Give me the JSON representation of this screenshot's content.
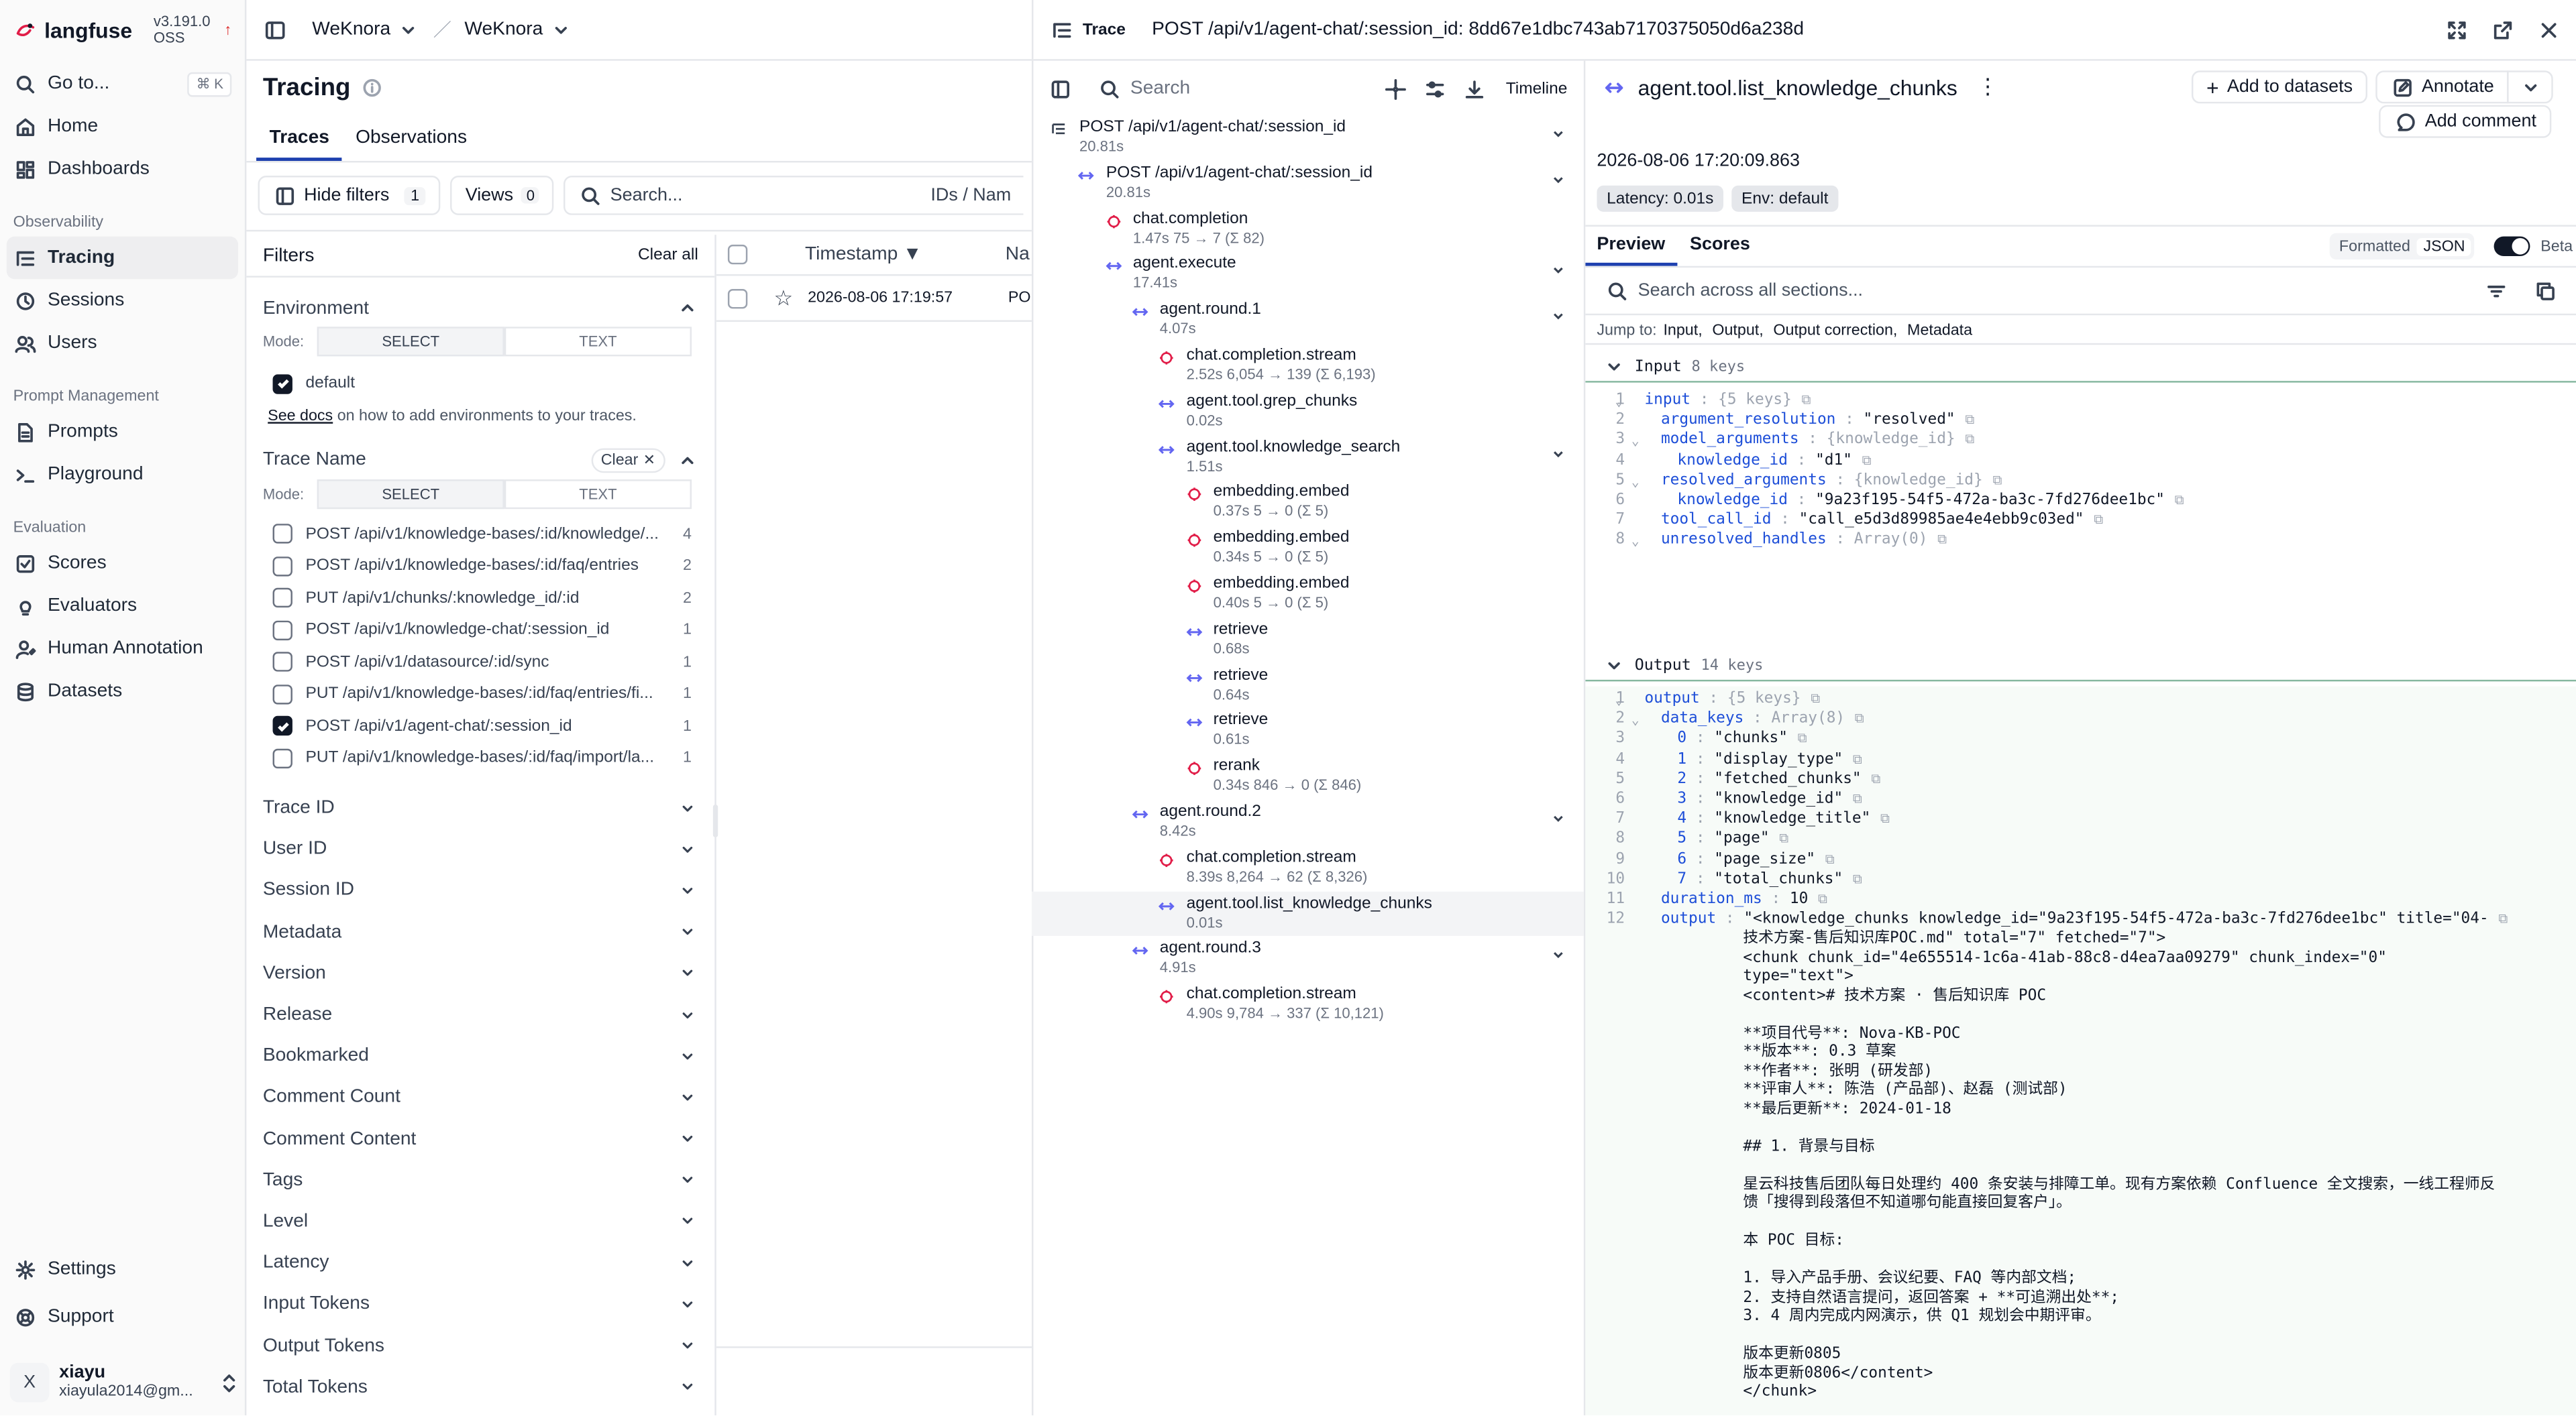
{
  "app": {
    "logo": "langfuse",
    "version": "v3.191.0 OSS"
  },
  "breadcrumb": [
    "WeKnora",
    "WeKnora"
  ],
  "sidebar": {
    "goto": "Go to...",
    "goto_shortcut": "⌘ K",
    "top": [
      "Home",
      "Dashboards"
    ],
    "sections": [
      {
        "title": "Observability",
        "items": [
          "Tracing",
          "Sessions",
          "Users"
        ]
      },
      {
        "title": "Prompt Management",
        "items": [
          "Prompts",
          "Playground"
        ]
      },
      {
        "title": "Evaluation",
        "items": [
          "Scores",
          "Evaluators",
          "Human Annotation",
          "Datasets"
        ]
      }
    ],
    "bottom": [
      "Settings",
      "Support"
    ],
    "user": {
      "initial": "X",
      "name": "xiayu",
      "email": "xiayula2014@gm..."
    }
  },
  "page": {
    "title": "Tracing",
    "tabs": [
      "Traces",
      "Observations"
    ],
    "hide_filters": "Hide filters",
    "hide_filters_count": "1",
    "views": "Views",
    "views_count": "0",
    "search_placeholder": "Search...",
    "search_scope": "IDs / Nam"
  },
  "filters": {
    "title": "Filters",
    "clear_all": "Clear all",
    "environment": {
      "title": "Environment",
      "mode": "Mode:",
      "select": "SELECT",
      "text": "TEXT",
      "option": "default",
      "see_docs": "See docs",
      "docs_rest": " on how to add environments to your traces."
    },
    "trace_name": {
      "title": "Trace Name",
      "clear": "Clear",
      "mode": "Mode:",
      "select": "SELECT",
      "text": "TEXT",
      "options": [
        {
          "label": "POST /api/v1/knowledge-bases/:id/knowledge/...",
          "count": "4",
          "checked": false
        },
        {
          "label": "POST /api/v1/knowledge-bases/:id/faq/entries",
          "count": "2",
          "checked": false
        },
        {
          "label": "PUT /api/v1/chunks/:knowledge_id/:id",
          "count": "2",
          "checked": false
        },
        {
          "label": "POST /api/v1/knowledge-chat/:session_id",
          "count": "1",
          "checked": false
        },
        {
          "label": "POST /api/v1/datasource/:id/sync",
          "count": "1",
          "checked": false
        },
        {
          "label": "PUT /api/v1/knowledge-bases/:id/faq/entries/fi...",
          "count": "1",
          "checked": false
        },
        {
          "label": "POST /api/v1/agent-chat/:session_id",
          "count": "1",
          "checked": true
        },
        {
          "label": "PUT /api/v1/knowledge-bases/:id/faq/import/la...",
          "count": "1",
          "checked": false
        }
      ]
    },
    "collapsed": [
      "Trace ID",
      "User ID",
      "Session ID",
      "Metadata",
      "Version",
      "Release",
      "Bookmarked",
      "Comment Count",
      "Comment Content",
      "Tags",
      "Level",
      "Latency",
      "Input Tokens",
      "Output Tokens",
      "Total Tokens"
    ]
  },
  "table": {
    "col_timestamp": "Timestamp ▼",
    "col_name": "Na",
    "row": {
      "timestamp": "2026-08-06 17:19:57",
      "name": "PO"
    }
  },
  "trace": {
    "label": "Trace",
    "title": "POST /api/v1/agent-chat/:session_id: 8dd67e1dbc743ab7170375050d6a238d",
    "search_placeholder": "Search",
    "timeline": "Timeline",
    "nodes": [
      {
        "name": "POST /api/v1/agent-chat/:session_id",
        "meta": "20.81s",
        "red": true
      },
      {
        "name": "POST /api/v1/agent-chat/:session_id",
        "meta": "20.81s",
        "red": true
      },
      {
        "name": "chat.completion",
        "meta": "1.47s   75 → 7 (Σ 82)",
        "red": false
      },
      {
        "name": "agent.execute",
        "meta": "17.41s",
        "red": true
      },
      {
        "name": "agent.round.1",
        "meta": "4.07s",
        "red": false
      },
      {
        "name": "chat.completion.stream",
        "meta": "2.52s   6,054 → 139 (Σ 6,193)",
        "red": false
      },
      {
        "name": "agent.tool.grep_chunks",
        "meta": "0.02s",
        "red": false
      },
      {
        "name": "agent.tool.knowledge_search",
        "meta": "1.51s",
        "red": false
      },
      {
        "name": "embedding.embed",
        "meta": "0.37s   5 → 0 (Σ 5)",
        "red": false
      },
      {
        "name": "embedding.embed",
        "meta": "0.34s   5 → 0 (Σ 5)",
        "red": false
      },
      {
        "name": "embedding.embed",
        "meta": "0.40s   5 → 0 (Σ 5)",
        "red": false
      },
      {
        "name": "retrieve",
        "meta": "0.68s",
        "red": false
      },
      {
        "name": "retrieve",
        "meta": "0.64s",
        "red": false
      },
      {
        "name": "retrieve",
        "meta": "0.61s",
        "red": false
      },
      {
        "name": "rerank",
        "meta": "0.34s   846 → 0 (Σ 846)",
        "red": false
      },
      {
        "name": "agent.round.2",
        "meta": "8.42s",
        "red": false
      },
      {
        "name": "chat.completion.stream",
        "meta": "8.39s   8,264 → 62 (Σ 8,326)",
        "red": false
      },
      {
        "name": "agent.tool.list_knowledge_chunks",
        "meta": "0.01s",
        "red": false
      },
      {
        "name": "agent.round.3",
        "meta": "4.91s",
        "red": false
      },
      {
        "name": "chat.completion.stream",
        "meta": "4.90s   9,784 → 337 (Σ 10,121)",
        "red": false
      }
    ]
  },
  "detail": {
    "title": "agent.tool.list_knowledge_chunks",
    "add_to_datasets": "Add to datasets",
    "annotate": "Annotate",
    "add_comment": "Add comment",
    "timestamp": "2026-08-06 17:20:09.863",
    "latency": "Latency: 0.01s",
    "env": "Env: default",
    "tabs": [
      "Preview",
      "Scores"
    ],
    "formatted": "Formatted",
    "json": "JSON",
    "beta": "Beta",
    "search_placeholder": "Search across all sections...",
    "jump_to": "Jump to:",
    "jump_links": [
      "Input,",
      "Output,",
      "Output correction,",
      "Metadata"
    ],
    "input": {
      "title": "Input",
      "keys": "8 keys"
    },
    "output": {
      "title": "Output",
      "keys": "14 keys"
    },
    "input_lines": [
      {
        "n": "1",
        "ind": 0,
        "k": "input",
        "v": "",
        "h": "{5 keys}"
      },
      {
        "n": "2",
        "ind": 1,
        "k": "argument_resolution",
        "v": "\"resolved\"",
        "h": ""
      },
      {
        "n": "3",
        "ind": 1,
        "k": "model_arguments",
        "v": "",
        "h": "{knowledge_id}"
      },
      {
        "n": "4",
        "ind": 2,
        "k": "knowledge_id",
        "v": "\"d1\"",
        "h": ""
      },
      {
        "n": "5",
        "ind": 1,
        "k": "resolved_arguments",
        "v": "",
        "h": "{knowledge_id}"
      },
      {
        "n": "6",
        "ind": 2,
        "k": "knowledge_id",
        "v": "\"9a23f195-54f5-472a-ba3c-7fd276dee1bc\"",
        "h": ""
      },
      {
        "n": "7",
        "ind": 1,
        "k": "tool_call_id",
        "v": "\"call_e5d3d89985ae4e4ebb9c03ed\"",
        "h": ""
      },
      {
        "n": "8",
        "ind": 1,
        "k": "unresolved_handles",
        "v": "",
        "h": "Array(0)"
      }
    ],
    "output_lines": [
      {
        "n": "1",
        "ind": 0,
        "k": "output",
        "v": "",
        "h": "{5 keys}"
      },
      {
        "n": "2",
        "ind": 1,
        "k": "data_keys",
        "v": "",
        "h": "Array(8)"
      },
      {
        "n": "3",
        "ind": 2,
        "k": "0",
        "v": "\"chunks\"",
        "h": ""
      },
      {
        "n": "4",
        "ind": 2,
        "k": "1",
        "v": "\"display_type\"",
        "h": ""
      },
      {
        "n": "5",
        "ind": 2,
        "k": "2",
        "v": "\"fetched_chunks\"",
        "h": ""
      },
      {
        "n": "6",
        "ind": 2,
        "k": "3",
        "v": "\"knowledge_id\"",
        "h": ""
      },
      {
        "n": "7",
        "ind": 2,
        "k": "4",
        "v": "\"knowledge_title\"",
        "h": ""
      },
      {
        "n": "8",
        "ind": 2,
        "k": "5",
        "v": "\"page\"",
        "h": ""
      },
      {
        "n": "9",
        "ind": 2,
        "k": "6",
        "v": "\"page_size\"",
        "h": ""
      },
      {
        "n": "10",
        "ind": 2,
        "k": "7",
        "v": "\"total_chunks\"",
        "h": ""
      },
      {
        "n": "11",
        "ind": 1,
        "k": "duration_ms",
        "v": "10",
        "h": ""
      },
      {
        "n": "12",
        "ind": 1,
        "k": "output",
        "v": "\"<knowledge_chunks knowledge_id=\"9a23f195-54f5-472a-ba3c-7fd276dee1bc\" title=\"04-",
        "h": ""
      }
    ],
    "output_text": [
      "技术方案-售后知识库POC.md\" total=\"7\" fetched=\"7\">",
      "<chunk chunk_id=\"4e655514-1c6a-41ab-88c8-d4ea7aa09279\" chunk_index=\"0\"",
      "type=\"text\">",
      "<content># 技术方案 · 售后知识库 POC",
      "",
      "**项目代号**: Nova-KB-POC",
      "**版本**: 0.3 草案",
      "**作者**: 张明 (研发部)",
      "**评审人**: 陈浩 (产品部)、赵磊 (测试部)",
      "**最后更新**: 2024-01-18",
      "",
      "## 1. 背景与目标",
      "",
      "星云科技售后团队每日处理约 400 条安装与排障工单。现有方案依赖 Confluence 全文搜索，一线工程师反",
      "馈「搜得到段落但不知道哪句能直接回复客户」。",
      "",
      "本 POC 目标:",
      "",
      "1. 导入产品手册、会议纪要、FAQ 等内部文档;",
      "2. 支持自然语言提问，返回答案 + **可追溯出处**;",
      "3. 4 周内完成内网演示，供 Q1 规划会中期评审。",
      "",
      "版本更新0805",
      "版本更新0806</content>",
      "</chunk>"
    ]
  }
}
